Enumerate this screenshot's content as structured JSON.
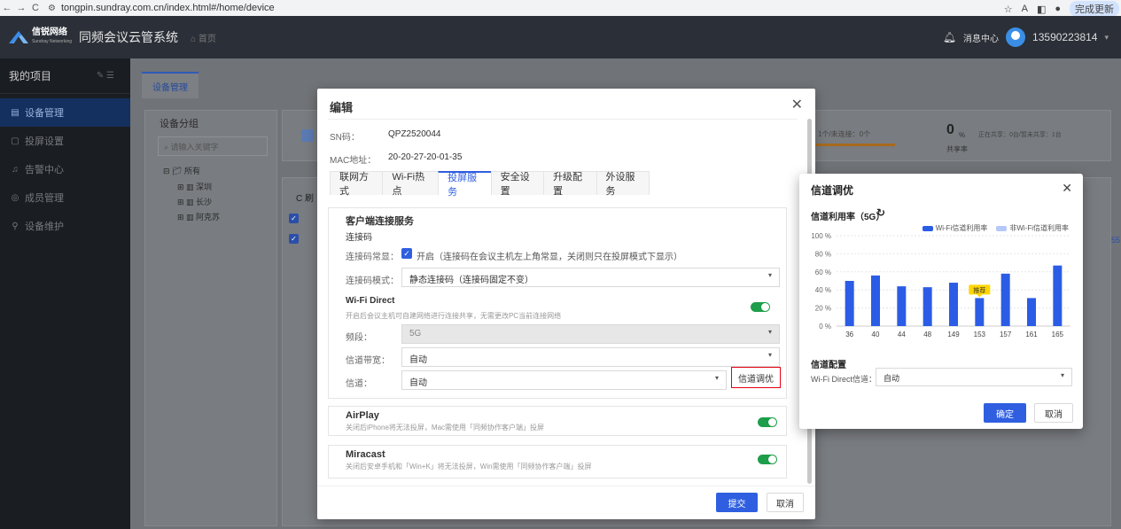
{
  "browser": {
    "url": "tongpin.sundray.com.cn/index.html#/home/device",
    "update_label": "完成更新"
  },
  "header": {
    "brand_cn": "信锐网络",
    "brand_en": "Sundray Networking",
    "system_title": "同频会议云管系统",
    "home_label": "首页",
    "message_center": "消息中心",
    "account": "13590223814"
  },
  "sidebar": {
    "project_title": "我的项目",
    "items": [
      {
        "label": "设备管理",
        "icon": "device-icon"
      },
      {
        "label": "投屏设置",
        "icon": "screen-icon"
      },
      {
        "label": "告警中心",
        "icon": "bell-icon"
      },
      {
        "label": "成员管理",
        "icon": "member-icon"
      },
      {
        "label": "设备维护",
        "icon": "wrench-icon"
      }
    ]
  },
  "main": {
    "tab": "设备管理",
    "group_title": "设备分组",
    "group_search_placeholder": "请输入关键字",
    "tree_root": "所有",
    "tree_children": [
      "深圳",
      "长沙",
      "阿克苏"
    ],
    "stat_offline": "1个/未连接：0个",
    "stat_share_count": "0",
    "stat_share_unit": "%",
    "stat_share_detail": "正在共享：0台/暂未共享：1台",
    "stat_share_label": "共享率",
    "list_toolbar_label": "C 刷",
    "partial_value": "55"
  },
  "edit_modal": {
    "title": "编辑",
    "sn_label": "SN码：",
    "sn_value": "QPZ2520044",
    "mac_label": "MAC地址：",
    "mac_value": "20-20-27-20-01-35",
    "tabs": [
      "联网方式",
      "Wi-Fi热点",
      "投屏服务",
      "安全设置",
      "升级配置",
      "外设服务"
    ],
    "active_tab": 2,
    "client_service_title": "客户端连接服务",
    "connect_code_title": "连接码",
    "code_resident_label": "连接码常显：",
    "code_resident_value": "开启（连接码在会议主机左上角常显，关闭则只在投屏模式下显示）",
    "code_mode_label": "连接码模式：",
    "code_mode_value": "静态连接码（连接码固定不变）",
    "wifi_direct_title": "Wi-Fi Direct",
    "wifi_direct_desc": "开启后会议主机可自建网络进行连接共享，无需更改PC当前连接网络",
    "band_label": "频段：",
    "band_value": "5G",
    "bandwidth_label": "信道带宽：",
    "bandwidth_value": "自动",
    "channel_label": "信道：",
    "channel_value": "自动",
    "channel_tune_button": "信道调优",
    "airplay_title": "AirPlay",
    "airplay_desc": "关闭后iPhone将无法投屏，Mac需使用「同频协作客户端」投屏",
    "miracast_title": "Miracast",
    "miracast_desc": "关闭后安卓手机和「Win+K」将无法投屏，Win需使用「同频协作客户端」投屏",
    "submit": "提交",
    "cancel": "取消"
  },
  "tune_dialog": {
    "title": "信道调优",
    "chart_title": "信道利用率（5G）",
    "config_title": "信道配置",
    "config_label": "Wi-Fi Direct信道：",
    "config_value": "自动",
    "ok": "确定",
    "cancel": "取消"
  },
  "colors": {
    "accent": "#2f5fe0",
    "bar": "#2b5ce6",
    "bar_other": "#b5c8f7",
    "toggle_on": "#1e9e4a",
    "recommend": "#ffd600",
    "highlight_border": "#e60012"
  },
  "chart_data": {
    "type": "bar",
    "categories": [
      "36",
      "40",
      "44",
      "48",
      "149",
      "153",
      "157",
      "161",
      "165"
    ],
    "series": [
      {
        "name": "Wi-Fi信道利用率",
        "values": [
          50,
          56,
          44,
          43,
          48,
          31,
          58,
          31,
          67
        ]
      },
      {
        "name": "非Wi-Fi信道利用率",
        "values": [
          0,
          0,
          0,
          0,
          0,
          0,
          0,
          0,
          0
        ]
      }
    ],
    "yticks": [
      "0 %",
      "20 %",
      "40 %",
      "60 %",
      "80 %",
      "100 %"
    ],
    "ylim": [
      0,
      100
    ],
    "recommended_category": "153",
    "recommended_label": "推荐",
    "grid": true,
    "legend_position": "top-right"
  }
}
